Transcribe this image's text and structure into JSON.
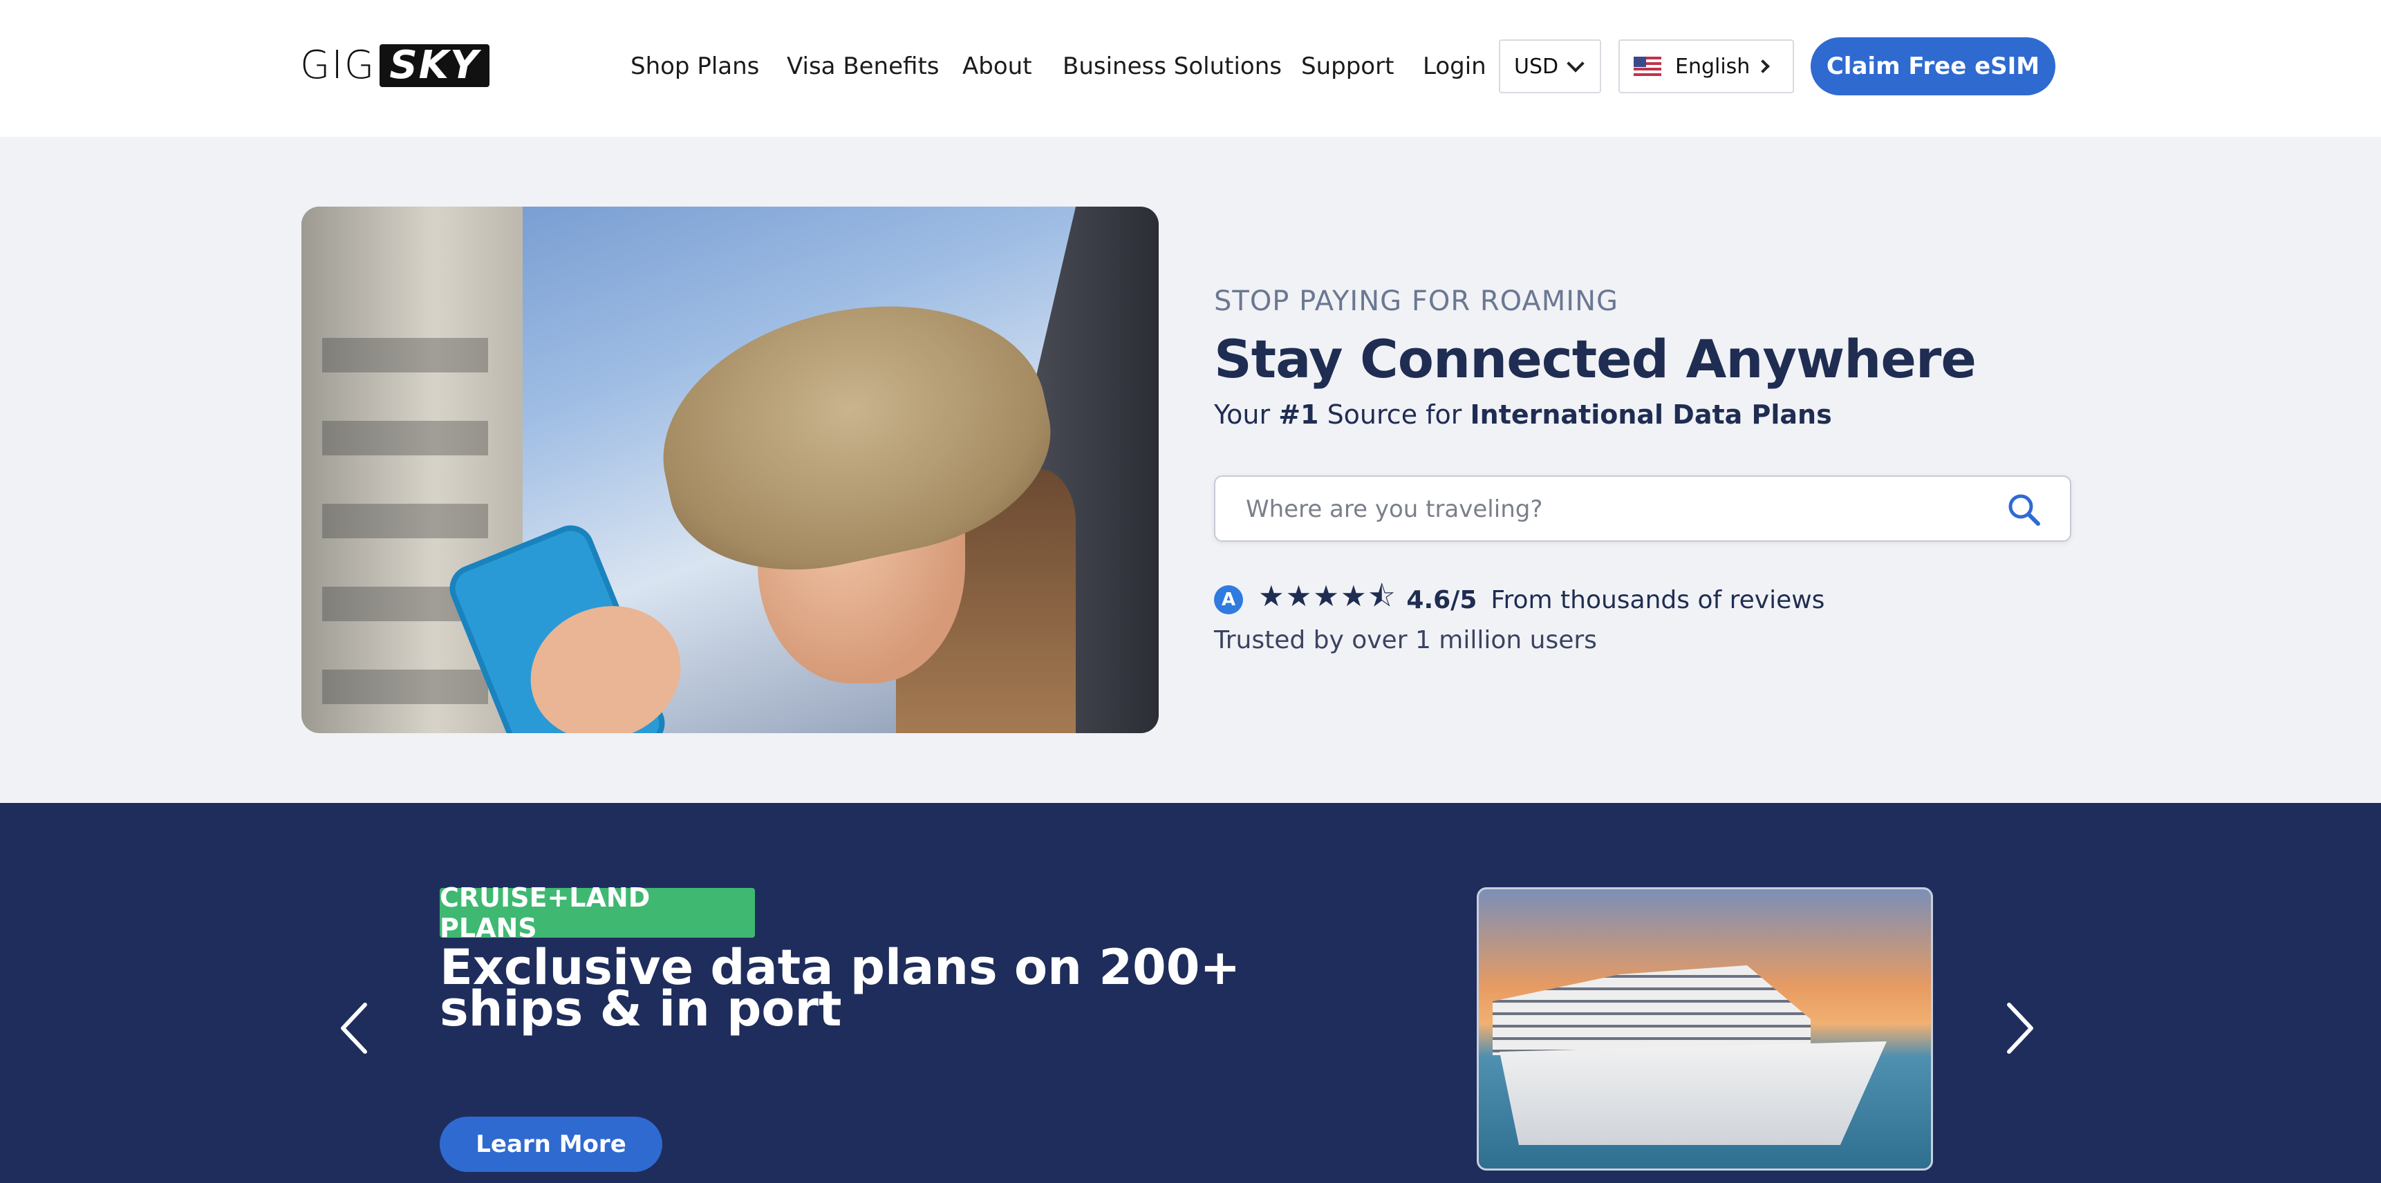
{
  "nav": {
    "logo_gig": "GIG",
    "logo_sky": "SKY",
    "links": [
      "Shop Plans",
      "Visa Benefits",
      "About",
      "Business Solutions",
      "Support",
      "Login"
    ],
    "currency": "USD",
    "language": "English",
    "cta": "Claim Free eSIM"
  },
  "hero": {
    "eyebrow": "STOP PAYING FOR ROAMING",
    "title": "Stay Connected Anywhere",
    "sub_prefix": "Your ",
    "sub_rank": "#1",
    "sub_mid": " Source for ",
    "sub_strong": "International Data Plans",
    "search_placeholder": "Where are you traveling?",
    "rating_stars": 4.6,
    "rating_score": "4.6/5",
    "rating_text": "From thousands of reviews",
    "trusted": "Trusted by over 1 million users"
  },
  "promo": {
    "tag": "CRUISE+LAND PLANS",
    "title": "Exclusive data plans on 200+ ships & in port",
    "button": "Learn More"
  },
  "colors": {
    "brand_blue": "#2f6ad1",
    "navy": "#1f2d5c",
    "tag_green": "#3fb872",
    "hero_bg": "#f1f2f6"
  }
}
